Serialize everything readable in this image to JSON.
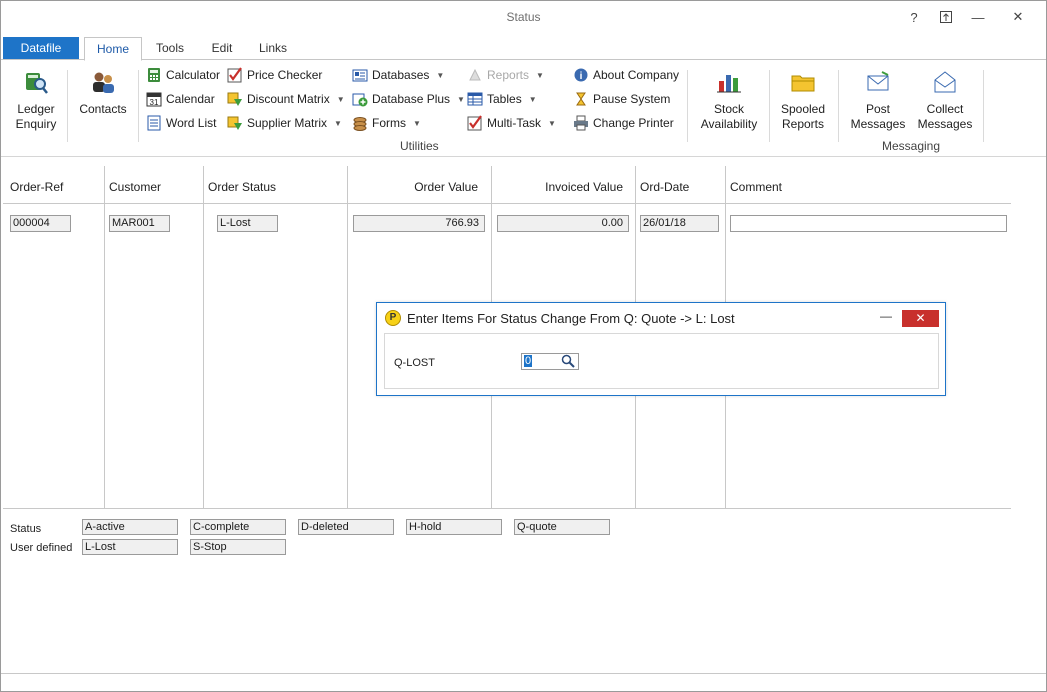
{
  "window": {
    "title": "Status"
  },
  "titlebar": {
    "help": "?",
    "restore": "⧉",
    "minimize": "—",
    "close": "✕"
  },
  "tabs": {
    "datafile": "Datafile",
    "home": "Home",
    "tools": "Tools",
    "edit": "Edit",
    "links": "Links"
  },
  "ribbon": {
    "ledger_enquiry": "Ledger Enquiry",
    "contacts": "Contacts",
    "calculator": "Calculator",
    "calendar": "Calendar",
    "word_list": "Word List",
    "price_checker": "Price Checker",
    "discount_matrix": "Discount Matrix",
    "supplier_matrix": "Supplier Matrix",
    "databases": "Databases",
    "database_plus": "Database Plus",
    "forms": "Forms",
    "reports": "Reports",
    "tables": "Tables",
    "multi_task": "Multi-Task",
    "about_company": "About Company",
    "pause_system": "Pause System",
    "change_printer": "Change Printer",
    "stock_availability": "Stock Availability",
    "spooled_reports": "Spooled Reports",
    "post_messages": "Post Messages",
    "collect_messages": "Collect Messages",
    "group_utilities": "Utilities",
    "group_messaging": "Messaging",
    "calendar_icon_text": "31"
  },
  "grid": {
    "headers": {
      "order_ref": "Order-Ref",
      "customer": "Customer",
      "order_status": "Order Status",
      "order_value": "Order Value",
      "invoiced_value": "Invoiced Value",
      "ord_date": "Ord-Date",
      "comment": "Comment"
    },
    "row": {
      "order_ref": "000004",
      "customer": "MAR001",
      "order_status": "L-Lost",
      "order_value": "766.93",
      "invoiced_value": "0.00",
      "ord_date": "26/01/18",
      "comment": ""
    }
  },
  "legend": {
    "status_label": "Status",
    "user_label": "User defined",
    "status_items": [
      "A-active",
      "C-complete",
      "D-deleted",
      "H-hold",
      "Q-quote"
    ],
    "user_items": [
      "L-Lost",
      "S-Stop"
    ]
  },
  "dialog": {
    "title": "Enter Items For Status Change From Q: Quote -> L: Lost",
    "logo": "P",
    "minimize": "—",
    "close": "✕",
    "field_label": "Q-LOST",
    "field_value": "0"
  },
  "colors": {
    "accent": "#1e74c8",
    "close_red": "#c8302c"
  }
}
